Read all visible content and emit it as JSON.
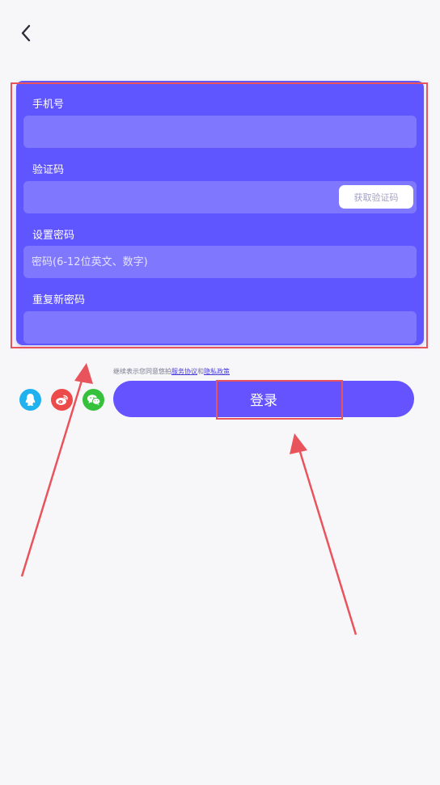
{
  "form": {
    "phone_label": "手机号",
    "phone_value": "",
    "code_label": "验证码",
    "code_value": "",
    "get_code_label": "获取验证码",
    "password_label": "设置密码",
    "password_placeholder": "密码(6-12位英文、数字)",
    "repeat_label": "重复新密码",
    "repeat_value": ""
  },
  "agreement": {
    "prefix": "继续表示您同意悠拍",
    "service_link": "服务协议",
    "and": "和",
    "privacy_link": "隐私政策"
  },
  "login": {
    "label": "登录"
  },
  "social": [
    {
      "name": "qq-icon",
      "color": "#1fb2ee"
    },
    {
      "name": "weibo-icon",
      "color": "#ec4b4a"
    },
    {
      "name": "wechat-icon",
      "color": "#36c13d"
    }
  ],
  "colors": {
    "card": "#6056ff",
    "input": "#7f78ff",
    "button": "#6453ff",
    "annotation": "#e9535c"
  }
}
